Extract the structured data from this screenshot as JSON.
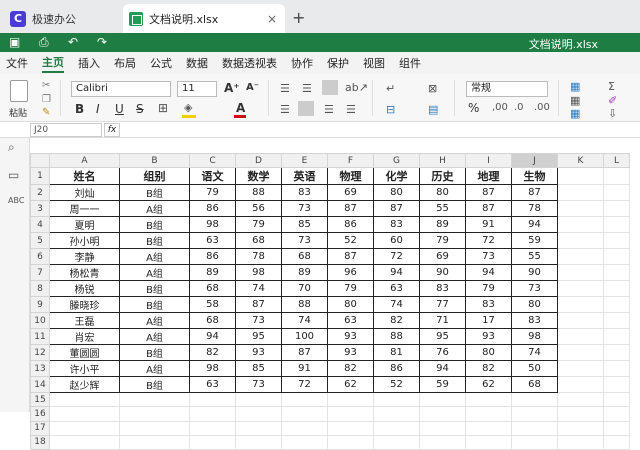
{
  "tabs": {
    "app_name": "极速办公",
    "app_logo": "C",
    "file_name": "文档说明.xlsx",
    "close_glyph": "×",
    "new_tab_glyph": "+"
  },
  "quickbar": {
    "title": "文档说明.xlsx",
    "colors": {
      "accent": "#1e7d43"
    }
  },
  "menu": {
    "items": [
      "文件",
      "主页",
      "插入",
      "布局",
      "公式",
      "数据",
      "数据透视表",
      "协作",
      "保护",
      "视图",
      "组件"
    ],
    "active_index": 1
  },
  "ribbon": {
    "paste_label": "粘贴",
    "font_name": "Calibri",
    "font_size": "11",
    "number_format": "常规",
    "bold": "B",
    "italic": "I",
    "underline": "U",
    "strike": "S",
    "grow_font": "A⁺",
    "shrink_font": "A⁻",
    "font_color": "A",
    "percent": "%"
  },
  "formula": {
    "name_box": "J20",
    "fx_label": "fx"
  },
  "sheet": {
    "columns": [
      "A",
      "B",
      "C",
      "D",
      "E",
      "F",
      "G",
      "H",
      "I",
      "J",
      "K",
      "L"
    ],
    "selected_column": "J",
    "rows": [
      "1",
      "2",
      "3",
      "4",
      "5",
      "6",
      "7",
      "8",
      "9",
      "10",
      "11",
      "12",
      "13",
      "14",
      "15",
      "16",
      "17",
      "18"
    ],
    "table": [
      [
        "姓名",
        "组别",
        "语文",
        "数学",
        "英语",
        "物理",
        "化学",
        "历史",
        "地理",
        "生物"
      ],
      [
        "刘灿",
        "B组",
        "79",
        "88",
        "83",
        "69",
        "80",
        "80",
        "87",
        "87"
      ],
      [
        "周一一",
        "A组",
        "86",
        "56",
        "73",
        "87",
        "87",
        "55",
        "87",
        "78"
      ],
      [
        "夏明",
        "B组",
        "98",
        "79",
        "85",
        "86",
        "83",
        "89",
        "91",
        "94"
      ],
      [
        "孙小明",
        "B组",
        "63",
        "68",
        "73",
        "52",
        "60",
        "79",
        "72",
        "59"
      ],
      [
        "李静",
        "A组",
        "86",
        "78",
        "68",
        "87",
        "72",
        "69",
        "73",
        "55"
      ],
      [
        "杨松青",
        "A组",
        "89",
        "98",
        "89",
        "96",
        "94",
        "90",
        "94",
        "90"
      ],
      [
        "杨锐",
        "B组",
        "68",
        "74",
        "70",
        "79",
        "63",
        "83",
        "79",
        "73"
      ],
      [
        "滕晓珍",
        "B组",
        "58",
        "87",
        "88",
        "80",
        "74",
        "77",
        "83",
        "80"
      ],
      [
        "王磊",
        "A组",
        "68",
        "73",
        "74",
        "63",
        "82",
        "71",
        "17",
        "83"
      ],
      [
        "肖宏",
        "A组",
        "94",
        "95",
        "100",
        "93",
        "88",
        "95",
        "93",
        "98"
      ],
      [
        "董圆圆",
        "B组",
        "82",
        "93",
        "87",
        "93",
        "81",
        "76",
        "80",
        "74"
      ],
      [
        "许小平",
        "A组",
        "98",
        "85",
        "91",
        "82",
        "86",
        "94",
        "82",
        "50"
      ],
      [
        "赵少辉",
        "B组",
        "63",
        "73",
        "72",
        "62",
        "52",
        "59",
        "62",
        "68"
      ]
    ]
  }
}
